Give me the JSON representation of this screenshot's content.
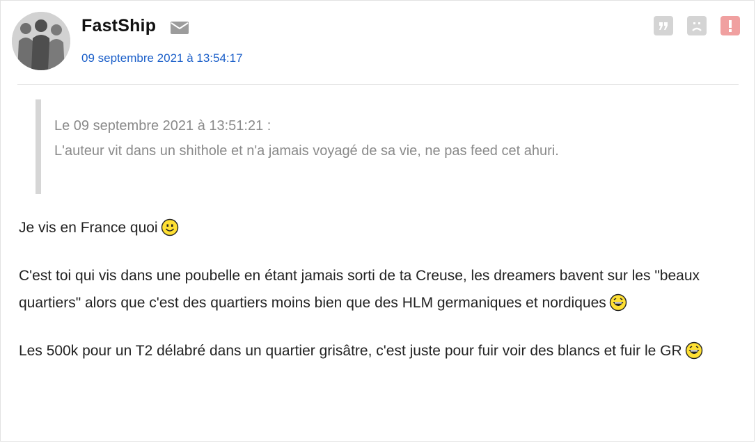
{
  "post": {
    "author": "FastShip",
    "date": "09 septembre 2021 à 13:54:17",
    "quote": {
      "header": "Le 09 septembre 2021 à 13:51:21 :",
      "text": "L'auteur vit dans un shithole et n'a jamais voyagé de sa vie, ne pas feed cet ahuri."
    },
    "paragraphs": [
      "Je vis en France quoi",
      "C'est toi qui vis dans une poubelle en étant jamais sorti de ta Creuse, les dreamers bavent sur les \"beaux quartiers\" alors que c'est des quartiers moins bien que des HLM germaniques et nordiques",
      "Les 500k pour un T2 délabré dans un quartier grisâtre, c'est juste pour fuir voir des blancs et fuir le GR"
    ]
  },
  "icons": {
    "mail": "envelope-icon",
    "quote_action": "quote-icon",
    "blacklist_action": "sad-face-icon",
    "report_action": "exclamation-icon"
  },
  "colors": {
    "link": "#1b5fc9",
    "quote_text": "#8a8a8a",
    "action_gray": "#d4d4d4",
    "report": "#f0a0a0"
  }
}
